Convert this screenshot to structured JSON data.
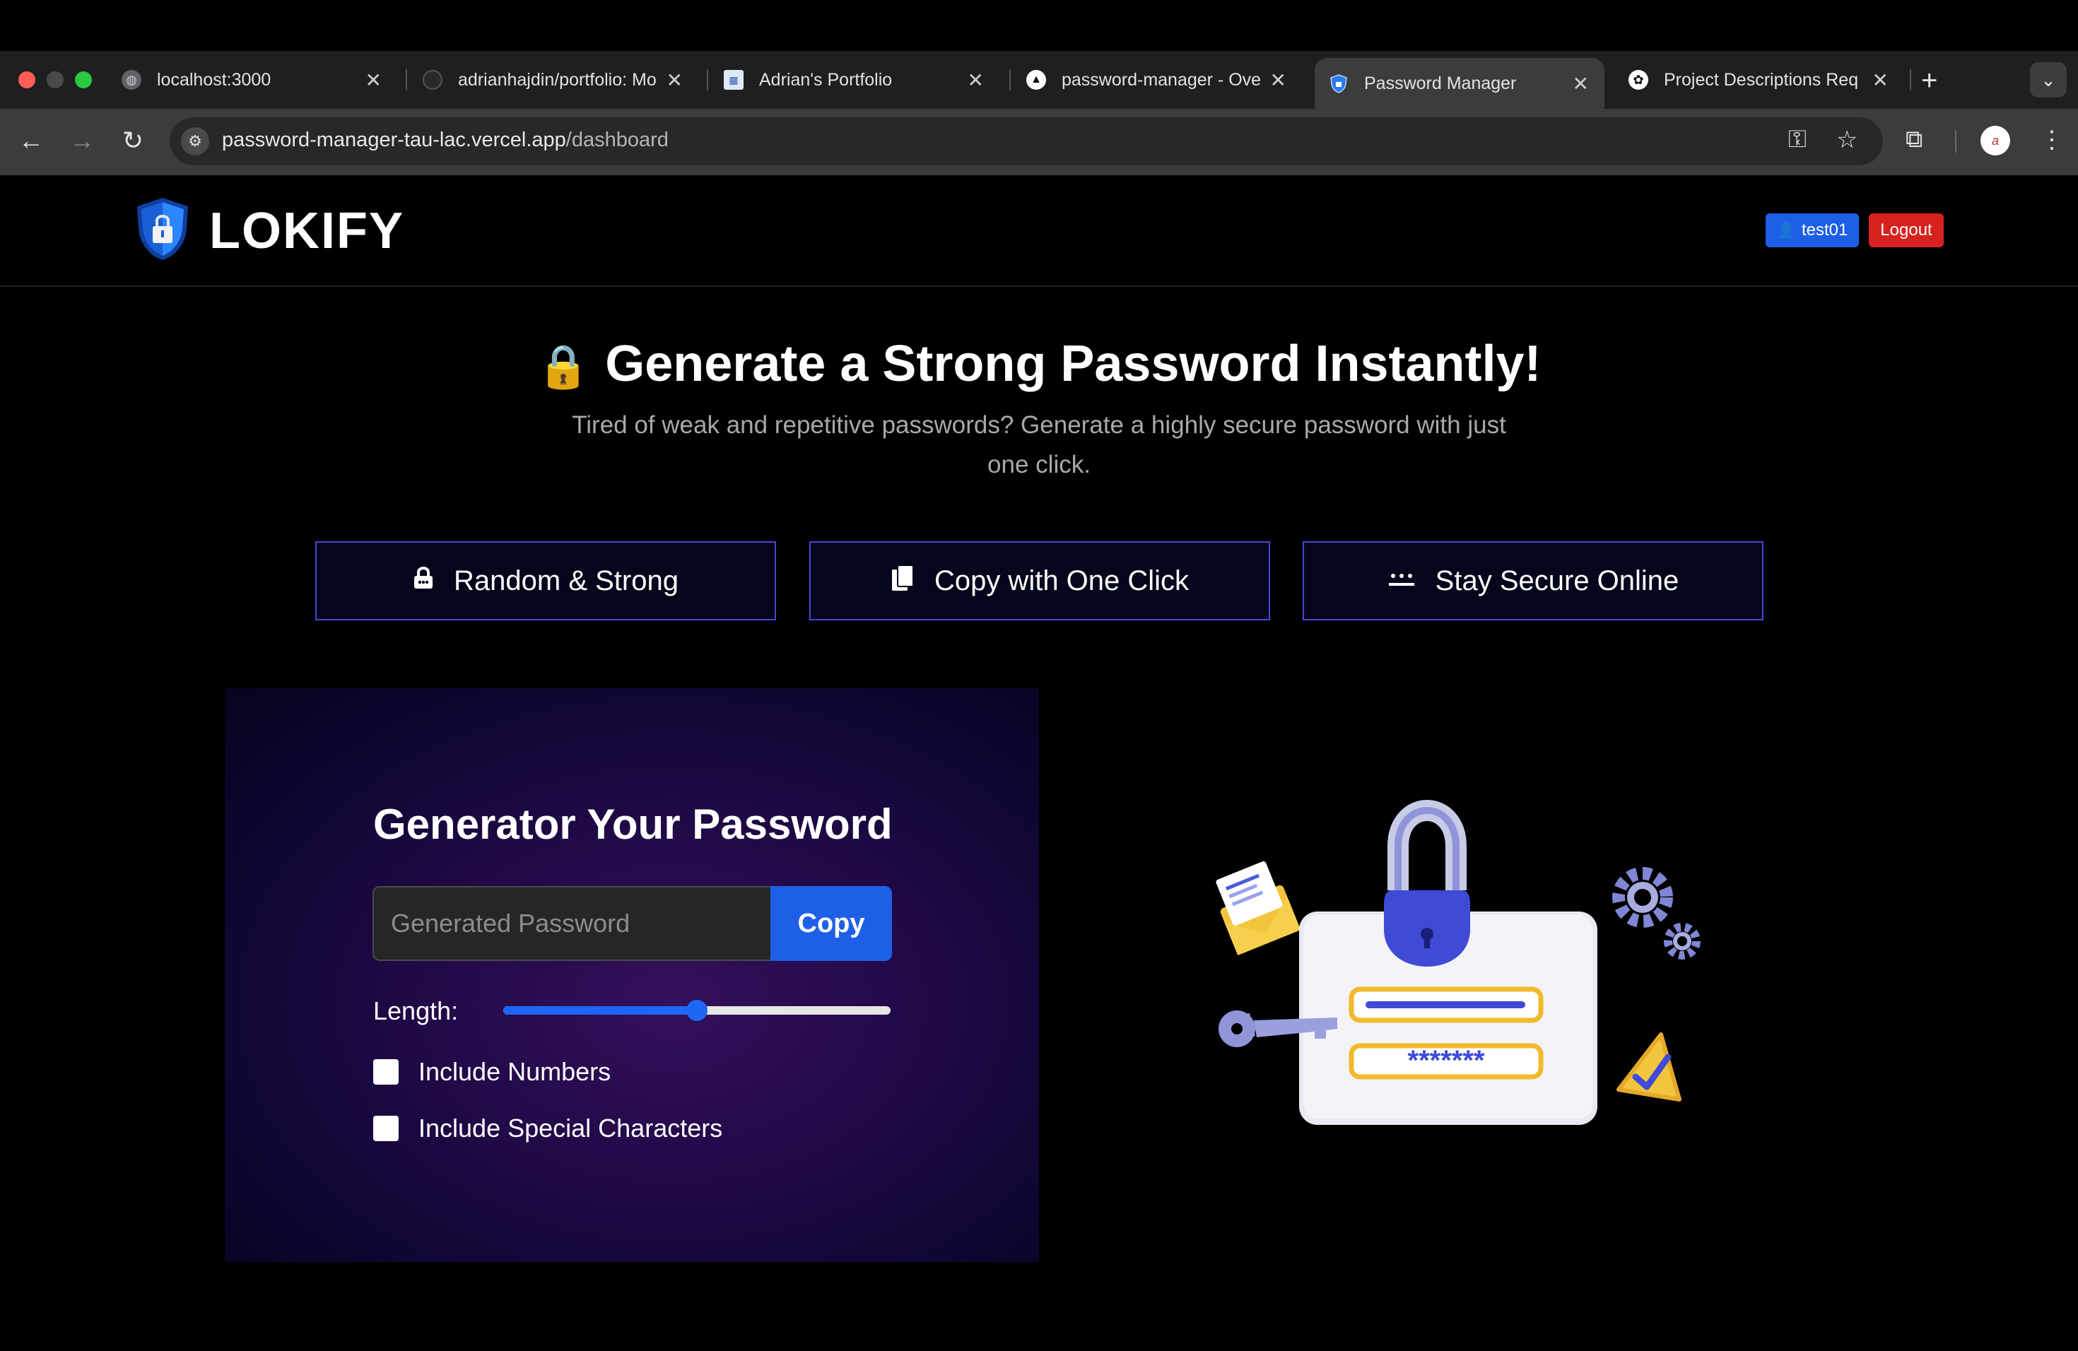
{
  "browser": {
    "tabs": [
      {
        "title": "localhost:3000",
        "favicon": "globe-icon"
      },
      {
        "title": "adrianhajdin/portfolio: Mo",
        "favicon": "github-icon"
      },
      {
        "title": "Adrian's Portfolio",
        "favicon": "portfolio-icon"
      },
      {
        "title": "password-manager - Ove",
        "favicon": "vercel-icon"
      },
      {
        "title": "Password Manager",
        "favicon": "shield-icon",
        "active": true
      },
      {
        "title": "Project Descriptions Req",
        "favicon": "openai-icon"
      }
    ],
    "url_host": "password-manager-tau-lac.vercel.app",
    "url_path": "/dashboard"
  },
  "navbar": {
    "logo_text": "LOKIFY",
    "user_label": "test01",
    "logout_label": "Logout"
  },
  "hero": {
    "title": "Generate a Strong Password Instantly!",
    "subtitle": "Tired of weak and repetitive passwords? Generate a highly secure password with just one click."
  },
  "features": [
    {
      "label": "Random & Strong",
      "icon": "lock-icon"
    },
    {
      "label": "Copy with One Click",
      "icon": "copy-icon"
    },
    {
      "label": "Stay Secure Online",
      "icon": "password-dots-icon"
    }
  ],
  "generator": {
    "title": "Generator Your Password",
    "input_placeholder": "Generated Password",
    "copy_label": "Copy",
    "length_label": "Length:",
    "length_slider_fraction": 0.5,
    "include_numbers_label": "Include Numbers",
    "include_numbers_checked": false,
    "include_special_label": "Include Special Characters",
    "include_special_checked": false
  },
  "illustration": {
    "password_mask": "*******"
  },
  "colors": {
    "primary_blue": "#1e5fe8",
    "logout_red": "#d7211e",
    "feature_border": "#4a45d0"
  }
}
